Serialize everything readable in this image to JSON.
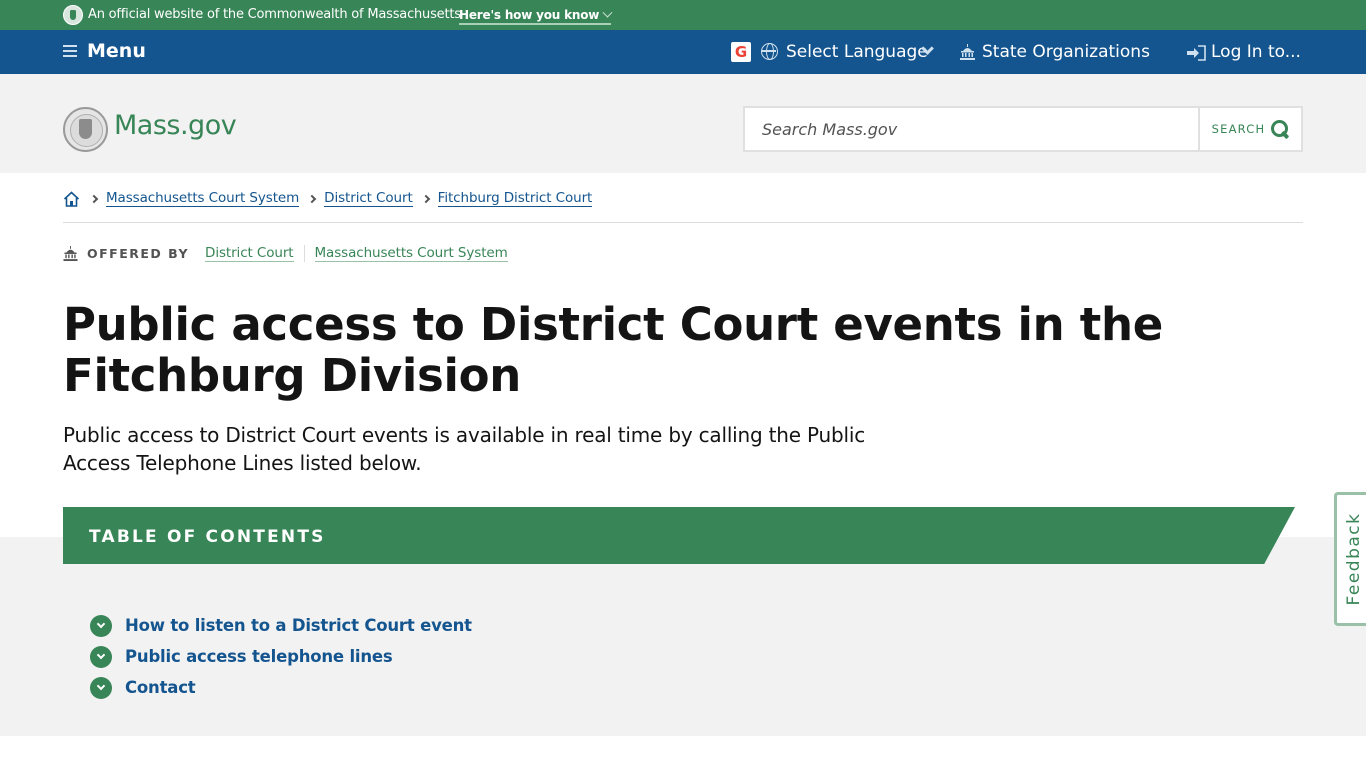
{
  "official_banner": {
    "text": "An official website of the Commonwealth of Massachusetts",
    "how_link": "Here's how you know"
  },
  "nav": {
    "menu_label": "Menu",
    "google_icon_letter": "G",
    "language_label": "Select Language",
    "state_orgs_label": "State Organizations",
    "login_label": "Log In to..."
  },
  "header": {
    "brand": "Mass.gov",
    "search_placeholder": "Search Mass.gov",
    "search_button": "SEARCH"
  },
  "breadcrumbs": [
    "Massachusetts Court System",
    "District Court",
    "Fitchburg District Court"
  ],
  "offered_by": {
    "label": "OFFERED BY",
    "orgs": [
      "District Court",
      "Massachusetts Court System"
    ]
  },
  "page": {
    "title": "Public access to District Court events in the Fitchburg Division",
    "lede": "Public access to District Court events is available in real time by calling the Public Access Telephone Lines listed below."
  },
  "toc": {
    "title": "TABLE OF CONTENTS",
    "items": [
      "How to listen to a District Court event",
      "Public access telephone lines",
      "Contact"
    ]
  },
  "feedback": {
    "label": "Feedback"
  },
  "colors": {
    "green": "#388557",
    "blue": "#14558f",
    "light_gray": "#f2f2f2"
  }
}
